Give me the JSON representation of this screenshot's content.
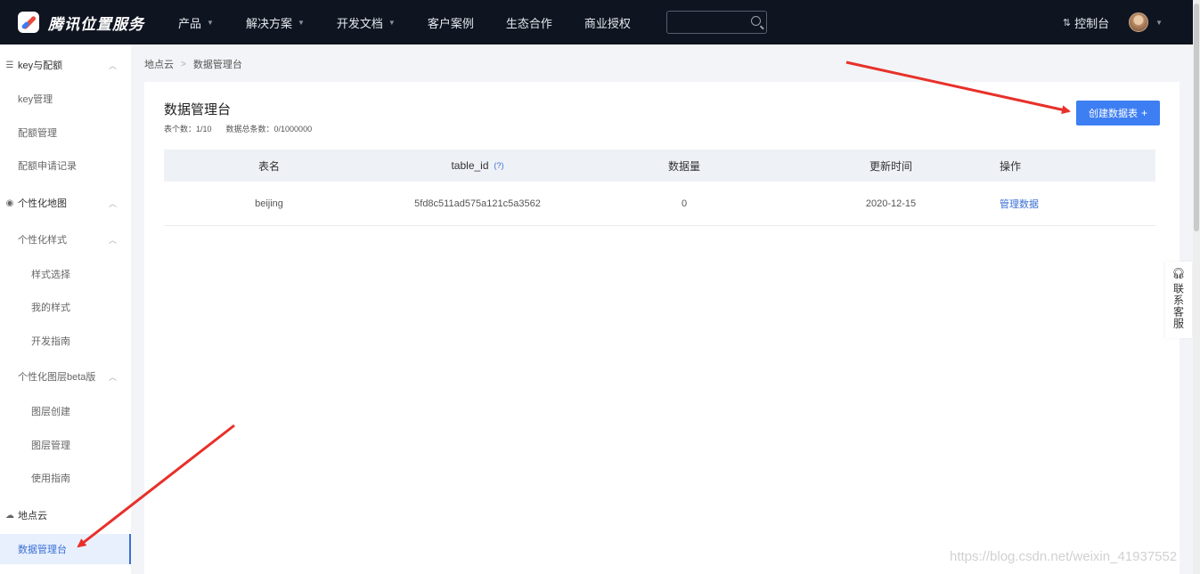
{
  "header": {
    "logo_text": "腾讯位置服务",
    "nav": [
      {
        "label": "产品",
        "caret": true
      },
      {
        "label": "解决方案",
        "caret": true
      },
      {
        "label": "开发文档",
        "caret": true
      },
      {
        "label": "客户案例",
        "caret": false
      },
      {
        "label": "生态合作",
        "caret": false
      },
      {
        "label": "商业授权",
        "caret": false
      }
    ],
    "search_placeholder": "",
    "console_label": "控制台"
  },
  "sidebar": {
    "items": [
      {
        "label": "key与配额",
        "level": "group",
        "icon": "list-icon",
        "chevron": true
      },
      {
        "label": "key管理",
        "level": "l1"
      },
      {
        "label": "配额管理",
        "level": "l1"
      },
      {
        "label": "配额申请记录",
        "level": "l1"
      },
      {
        "label": "个性化地图",
        "level": "group",
        "icon": "palette-icon",
        "chevron": true
      },
      {
        "label": "个性化样式",
        "level": "l1",
        "chevron": true
      },
      {
        "label": "样式选择",
        "level": "l2"
      },
      {
        "label": "我的样式",
        "level": "l2"
      },
      {
        "label": "开发指南",
        "level": "l2"
      },
      {
        "label": "个性化图层beta版",
        "level": "l1",
        "chevron": true
      },
      {
        "label": "图层创建",
        "level": "l2"
      },
      {
        "label": "图层管理",
        "level": "l2"
      },
      {
        "label": "使用指南",
        "level": "l2"
      },
      {
        "label": "地点云",
        "level": "group",
        "icon": "cloud-icon"
      },
      {
        "label": "数据管理台",
        "level": "l1",
        "active": true
      }
    ]
  },
  "breadcrumb": {
    "parent": "地点云",
    "current": "数据管理台"
  },
  "main": {
    "title": "数据管理台",
    "table_count": "表个数：1/10",
    "data_total": "数据总条数：0/1000000",
    "create_button": "创建数据表",
    "table": {
      "columns": [
        "表名",
        "table_id",
        "数据量",
        "更新时间",
        "操作"
      ],
      "help": "(?)",
      "rows": [
        {
          "name": "beijing",
          "table_id": "5fd8c511ad575a121c5a3562",
          "count": "0",
          "updated": "2020-12-15",
          "action": "管理数据"
        }
      ]
    }
  },
  "side_tab": {
    "label": "联系客服"
  },
  "watermark": "https://blog.csdn.net/weixin_41937552",
  "colors": {
    "topbar": "#0e1420",
    "primary": "#3d7ef2",
    "link": "#3b6fd6",
    "arrow": "#e8302a"
  }
}
